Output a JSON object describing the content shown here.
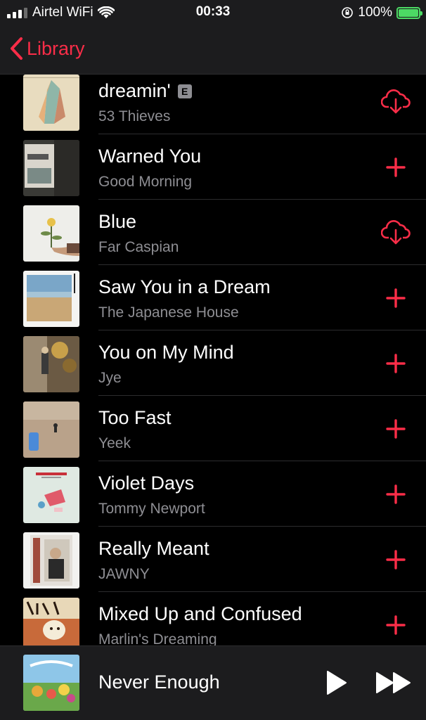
{
  "status_bar": {
    "carrier": "Airtel WiFi",
    "time": "00:33",
    "battery": "100%",
    "battery_level": 1.0
  },
  "nav": {
    "back_label": "Library",
    "back_icon": "chevron-left-icon"
  },
  "colors": {
    "accent": "#fa2d48",
    "background": "#000000",
    "bar_background": "#1c1c1e",
    "secondary_text": "#8e8e93",
    "battery_green": "#4cd964"
  },
  "songs": [
    {
      "title": "dreamin'",
      "artist": "53 Thieves",
      "explicit": true,
      "badge": "E",
      "action": "download-cloud-icon"
    },
    {
      "title": "Warned You",
      "artist": "Good Morning",
      "explicit": false,
      "action": "add-icon"
    },
    {
      "title": "Blue",
      "artist": "Far Caspian",
      "explicit": false,
      "action": "download-cloud-icon"
    },
    {
      "title": "Saw You in a Dream",
      "artist": "The Japanese House",
      "explicit": false,
      "action": "add-icon"
    },
    {
      "title": "You on My Mind",
      "artist": "Jye",
      "explicit": false,
      "action": "add-icon"
    },
    {
      "title": "Too Fast",
      "artist": "Yeek",
      "explicit": false,
      "action": "add-icon"
    },
    {
      "title": "Violet Days",
      "artist": "Tommy Newport",
      "explicit": false,
      "action": "add-icon"
    },
    {
      "title": "Really Meant",
      "artist": "JAWNY",
      "explicit": false,
      "action": "add-icon"
    },
    {
      "title": "Mixed Up and Confused",
      "artist": "Marlin's Dreaming",
      "explicit": false,
      "action": "add-icon"
    }
  ],
  "now_playing": {
    "title": "Never Enough",
    "play_icon": "play-icon",
    "forward_icon": "fast-forward-icon"
  }
}
